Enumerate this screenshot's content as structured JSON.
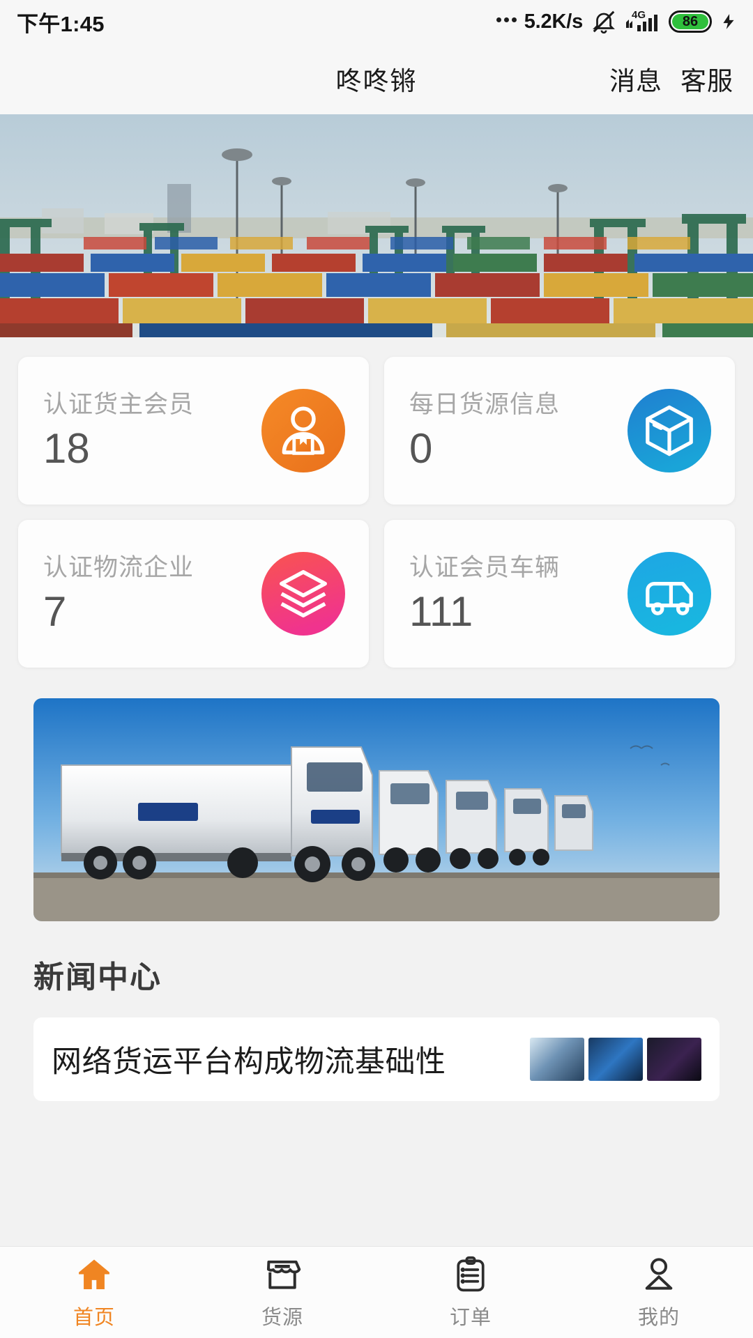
{
  "status_bar": {
    "time": "下午1:45",
    "network_speed": "5.2K/s",
    "dots_icon": "more-dots-icon",
    "mute_icon": "bell-muted-icon",
    "signal_icon": "signal-4g-icon",
    "network_type": "4G",
    "battery_level": "86",
    "charging_icon": "charging-bolt-icon"
  },
  "header": {
    "title": "咚咚锵",
    "messages_label": "消息",
    "support_label": "客服"
  },
  "banner": {
    "name": "port-container-yard-banner",
    "alt": "集装箱码头"
  },
  "stats": {
    "cards": [
      {
        "label": "认证货主会员",
        "value": "18",
        "icon": "shipper-member-icon",
        "color": "#ee7b1e"
      },
      {
        "label": "每日货源信息",
        "value": "0",
        "icon": "cargo-box-icon",
        "color": "#1b8ad6"
      },
      {
        "label": "认证物流企业",
        "value": "7",
        "icon": "layers-icon",
        "color": "#f4474f"
      },
      {
        "label": "认证会员车辆",
        "value": "111",
        "icon": "truck-icon",
        "color": "#1aa7e0"
      }
    ]
  },
  "promo": {
    "name": "truck-fleet-promo-image",
    "alt": "白色卡车车队"
  },
  "news": {
    "section_title": "新闻中心",
    "items": [
      {
        "title": "网络货运平台构成物流基础性",
        "thumbs": [
          "news-thumb-1",
          "news-thumb-2",
          "news-thumb-3"
        ]
      }
    ]
  },
  "tab_bar": {
    "tabs": [
      {
        "label": "首页",
        "icon": "home-icon",
        "active": true
      },
      {
        "label": "货源",
        "icon": "store-icon",
        "active": false
      },
      {
        "label": "订单",
        "icon": "clipboard-icon",
        "active": false
      },
      {
        "label": "我的",
        "icon": "person-icon",
        "active": false
      }
    ]
  },
  "colors": {
    "accent": "#f08522",
    "page_background": "#f2f2f2",
    "card_background": "#fdfdfd",
    "label_gray": "#a6a6a6",
    "value_gray": "#555555"
  }
}
